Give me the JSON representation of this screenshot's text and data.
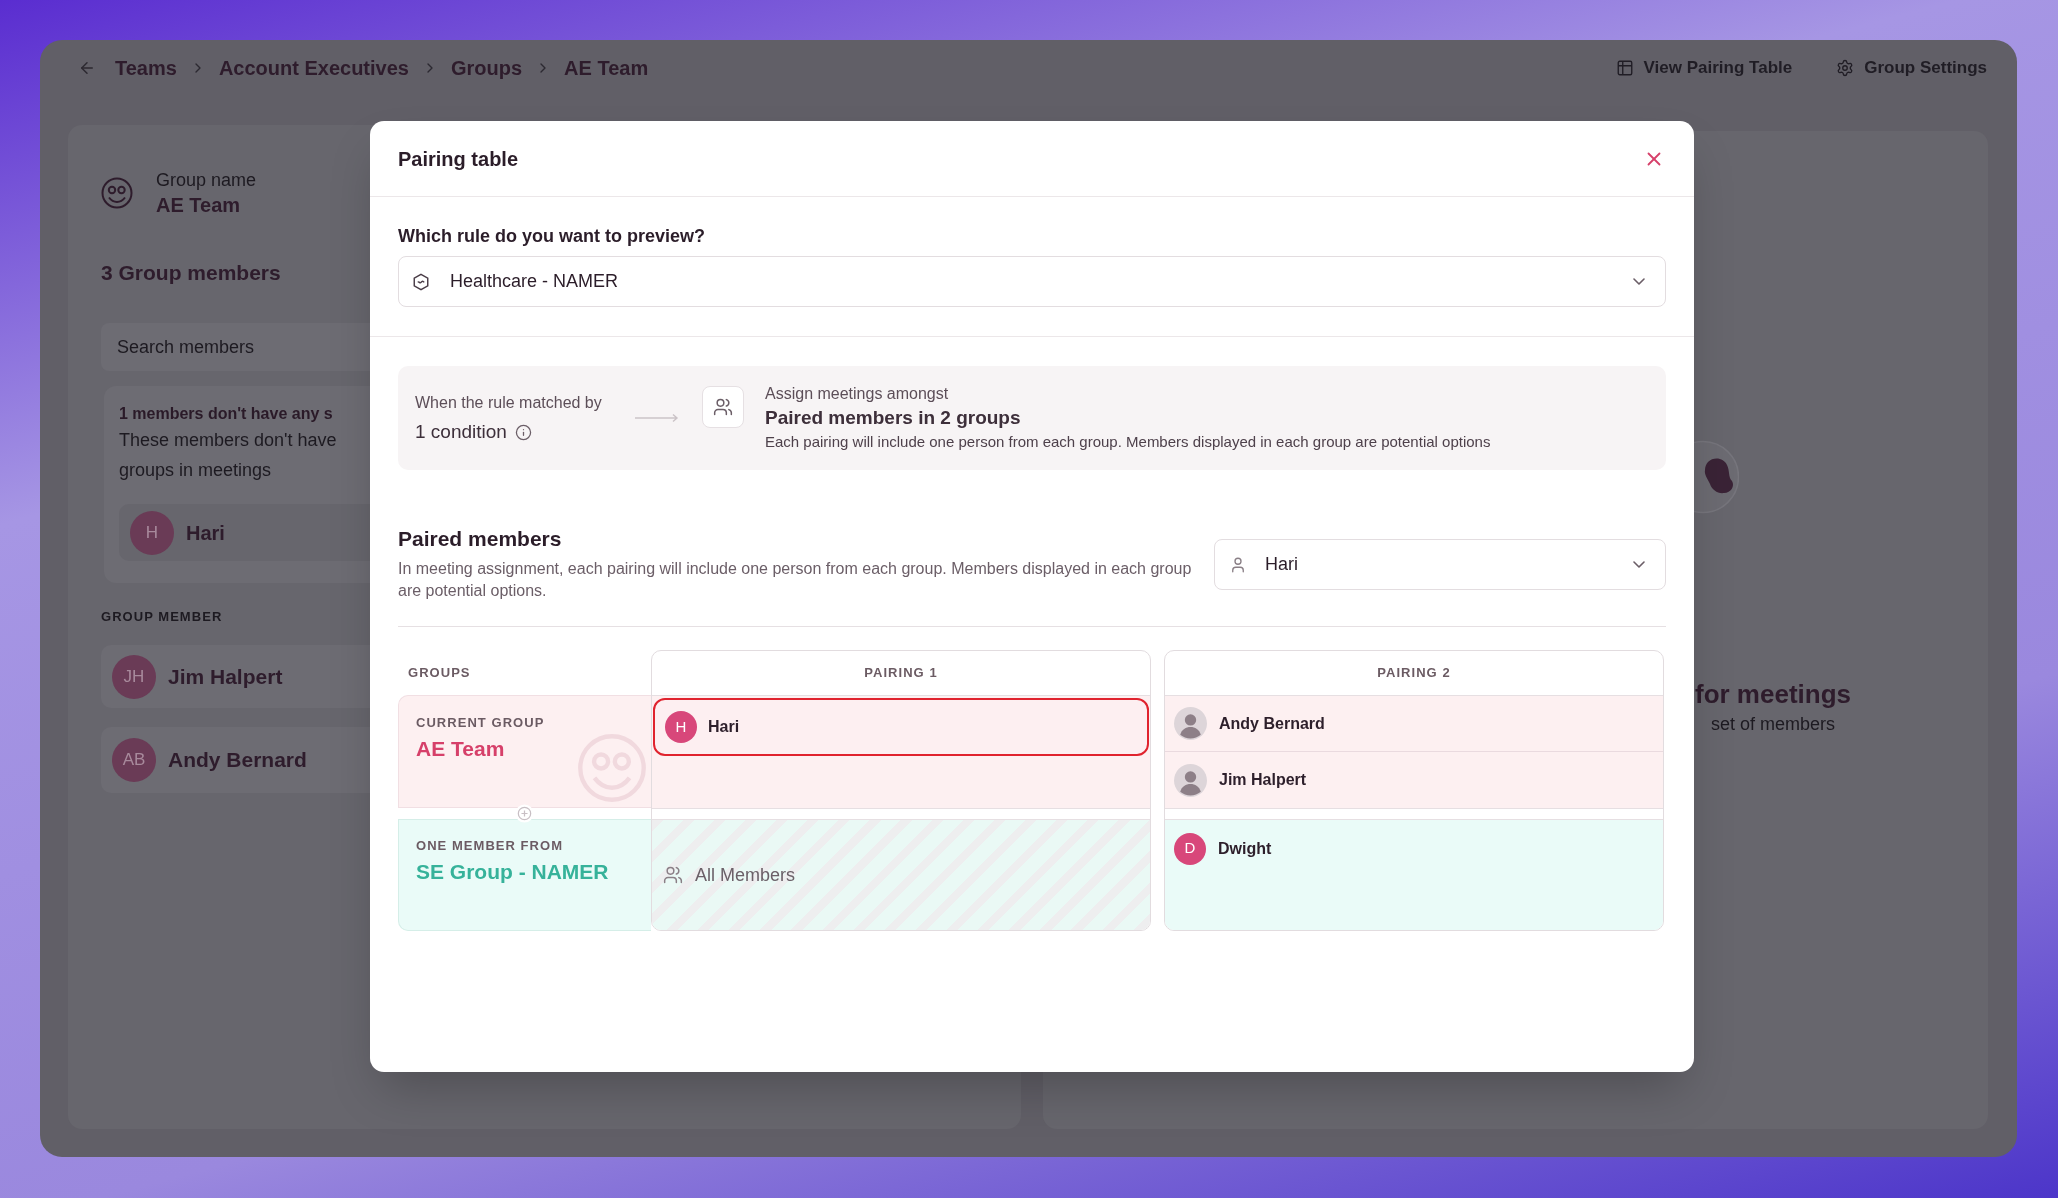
{
  "breadcrumb": [
    {
      "label": "Teams"
    },
    {
      "label": "Account Executives"
    },
    {
      "label": "Groups"
    },
    {
      "label": "AE Team"
    }
  ],
  "actions": [
    {
      "kind": "table",
      "label": "View Pairing Table"
    },
    {
      "kind": "settings",
      "label": "Group Settings"
    }
  ],
  "group_panel": {
    "name_label": "Group name",
    "name": "AE Team",
    "member_count": "3 Group members",
    "search": {
      "placeholder": "Search members"
    },
    "notice": {
      "title": "1 members don't have any s",
      "lines": [
        "These members don't have",
        "groups in meetings"
      ],
      "members": [
        {
          "initials": "H",
          "name": "Hari"
        }
      ]
    },
    "section_label": "GROUP MEMBER",
    "members": [
      {
        "initials": "JH",
        "name": "Jim Halpert"
      },
      {
        "initials": "AB",
        "name": "Andy Bernard"
      }
    ]
  },
  "empty_state": {
    "title": "for meetings",
    "subtitle": "set of members"
  },
  "modal": {
    "title": "Pairing table",
    "rule_question": "Which rule do you want to preview?",
    "rule_select": {
      "value": "Healthcare - NAMER"
    },
    "rule_summary": {
      "match_label": "When the rule matched by",
      "condition": "1 condition",
      "assign_label": "Assign meetings amongst",
      "assign_title": "Paired members in 2 groups",
      "assign_text": "Each pairing will include one person from each group. Members displayed in each group are potential options"
    },
    "paired_members": {
      "title": "Paired members",
      "text": "In meeting assignment, each pairing will include one person from each group. Members displayed in each group are potential options.",
      "member_select": {
        "value": "Hari"
      }
    },
    "table": {
      "groups_heading": "GROUPS",
      "groups": [
        {
          "kind": "current",
          "label": "CURRENT GROUP",
          "name": "AE Team"
        },
        {
          "kind": "other",
          "label": "ONE MEMBER FROM",
          "name": "SE Group - NAMER"
        }
      ],
      "pairings": [
        {
          "heading": "PAIRING 1",
          "cells": [
            {
              "kind": "members",
              "members": [
                {
                  "kind": "initial",
                  "name": "Hari",
                  "initials": "H",
                  "highlighted": true
                }
              ]
            },
            {
              "kind": "all",
              "label": "All Members"
            }
          ]
        },
        {
          "heading": "PAIRING 2",
          "cells": [
            {
              "kind": "members",
              "members": [
                {
                  "kind": "photo",
                  "name": "Andy Bernard",
                  "highlighted": false
                },
                {
                  "kind": "photo",
                  "name": "Jim Halpert",
                  "highlighted": false
                }
              ]
            },
            {
              "kind": "members",
              "members": [
                {
                  "kind": "initial",
                  "name": "Dwight",
                  "initials": "D",
                  "highlighted": false
                }
              ]
            }
          ]
        }
      ]
    }
  }
}
